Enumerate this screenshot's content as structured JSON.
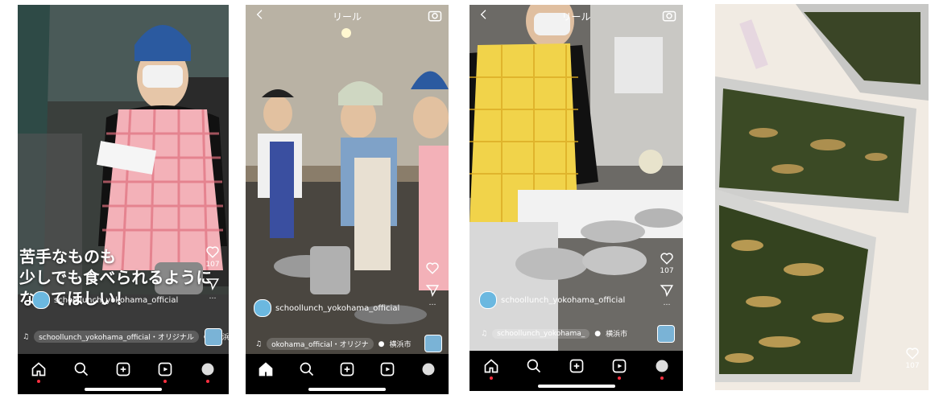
{
  "phones": [
    {
      "caption_line1": "苦手なものも",
      "caption_line2": "少しでも食べられるように",
      "caption_line3": "なってほしい！",
      "username": "schoollunch_yokohama_official",
      "audio_text": "schoollunch_yokohama_official・オリジナル",
      "location": "横浜市",
      "like_count": "107"
    },
    {
      "header_title": "リール",
      "username": "schoollunch_yokohama_official",
      "audio_text": "okohama_official・オリジナ",
      "location": "横浜市"
    },
    {
      "header_title": "リール",
      "username": "schoollunch_yokohama_official",
      "audio_text": "schoollunch_yokohama_",
      "location": "横浜市",
      "like_count": "107"
    },
    {
      "like_count": "107"
    }
  ],
  "nav_icons": [
    "home-icon",
    "search-icon",
    "create-icon",
    "reels-icon",
    "profile-icon"
  ]
}
